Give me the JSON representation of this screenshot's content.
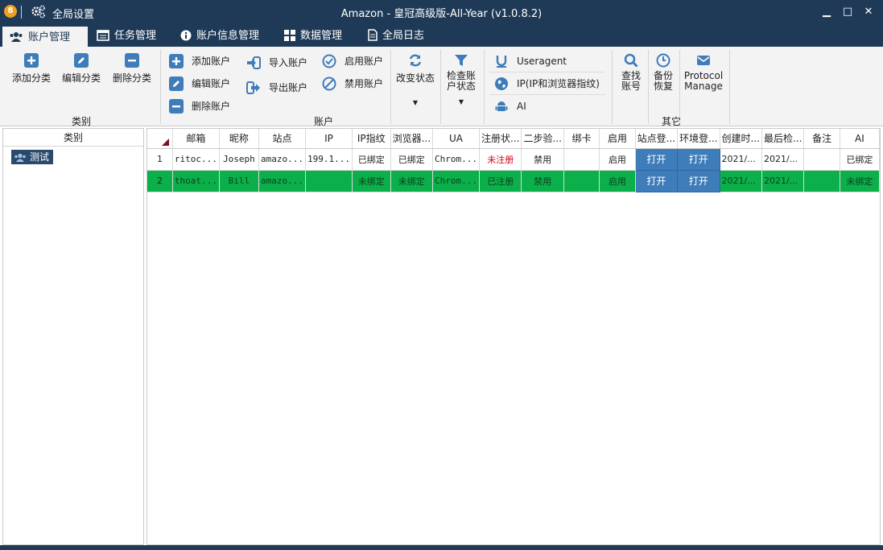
{
  "titlebar": {
    "app_icon_text": "8",
    "global_settings": "全局设置",
    "title": "Amazon - 皇冠高级版-All-Year  (v1.0.8.2)",
    "minimize": "▁",
    "maximize": "□",
    "close": "✕"
  },
  "tabs": [
    {
      "label": "账户管理",
      "icon": "users-icon",
      "active": true
    },
    {
      "label": "任务管理",
      "icon": "list-icon"
    },
    {
      "label": "账户信息管理",
      "icon": "info-icon"
    },
    {
      "label": "数据管理",
      "icon": "grid-icon"
    },
    {
      "label": "全局日志",
      "icon": "document-icon"
    }
  ],
  "ribbon": {
    "category_group": {
      "label": "类别",
      "add": "添加分类",
      "edit": "编辑分类",
      "delete": "删除分类"
    },
    "account_group": {
      "label": "账户",
      "add": "添加账户",
      "edit": "编辑账户",
      "delete": "删除账户",
      "import": "导入账户",
      "export": "导出账户",
      "enable": "启用账户",
      "disable": "禁用账户",
      "change_status": "改变状态",
      "check_status": "检查账户状态"
    },
    "env_group": {
      "useragent": "Useragent",
      "ip": "IP(IP和浏览器指纹)",
      "ai": "AI"
    },
    "other_group": {
      "label": "其它",
      "find": "查找账号",
      "backup": "备份恢复",
      "protocol": "Protocol Manage"
    }
  },
  "left_panel": {
    "header": "类别",
    "items": [
      {
        "label": "测试"
      }
    ]
  },
  "grid": {
    "columns": [
      "邮箱",
      "昵称",
      "站点",
      "IP",
      "IP指纹",
      "浏览器...",
      "UA",
      "注册状...",
      "二步验...",
      "绑卡",
      "启用",
      "站点登...",
      "环境登...",
      "创建时...",
      "最后检...",
      "备注",
      "AI"
    ],
    "rows": [
      {
        "num": "1",
        "email": "ritoc...",
        "nickname": "Joseph",
        "site": "amazo...",
        "ip": "199.1...",
        "ip_fp": "已绑定",
        "browser": "已绑定",
        "ua": "Chrom...",
        "reg": "未注册",
        "twostep": "禁用",
        "card": "",
        "enabled": "启用",
        "site_login": "打开",
        "env_login": "打开",
        "created": "2021/...",
        "last_check": "2021/...",
        "note": "",
        "ai": "已绑定"
      },
      {
        "num": "2",
        "email": "thoat...",
        "nickname": "Bill",
        "site": "amazo...",
        "ip": "",
        "ip_fp": "未绑定",
        "browser": "未绑定",
        "ua": "Chrom...",
        "reg": "已注册",
        "twostep": "禁用",
        "card": "",
        "enabled": "启用",
        "site_login": "打开",
        "env_login": "打开",
        "created": "2021/...",
        "last_check": "2021/...",
        "note": "",
        "ai": "未绑定"
      }
    ]
  },
  "colors": {
    "titlebar": "#1f3a57",
    "row_highlight": "#0bb04b",
    "button_blue": "#3f7cba",
    "unregistered_red": "#d0021b",
    "icon_blue": "#3f7cba"
  }
}
